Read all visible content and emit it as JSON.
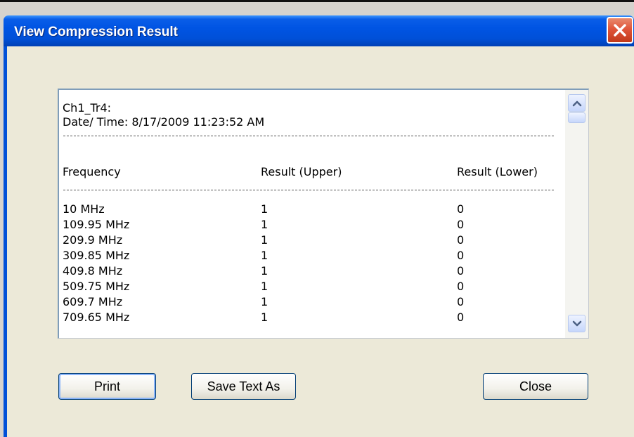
{
  "window": {
    "title": "View Compression Result"
  },
  "result": {
    "channel": "Ch1_Tr4:",
    "datetime": "Date/ Time: 8/17/2009 11:23:52 AM",
    "headers": [
      "Frequency",
      "Result (Upper)",
      "Result (Lower)"
    ],
    "rows": [
      [
        "10 MHz",
        "1",
        "0"
      ],
      [
        "109.95 MHz",
        "1",
        "0"
      ],
      [
        "209.9 MHz",
        "1",
        "0"
      ],
      [
        "309.85 MHz",
        "1",
        "0"
      ],
      [
        "409.8 MHz",
        "1",
        "0"
      ],
      [
        "509.75 MHz",
        "1",
        "0"
      ],
      [
        "609.7 MHz",
        "1",
        "0"
      ],
      [
        "709.65 MHz",
        "1",
        "0"
      ]
    ]
  },
  "buttons": {
    "print": "Print",
    "save_text_as": "Save Text As",
    "close": "Close"
  },
  "icons": {
    "close": "close-icon",
    "scroll_up": "chevron-up-icon",
    "scroll_down": "chevron-down-icon"
  },
  "colors": {
    "titlebar": "#0054e3",
    "dialog_background": "#ece9d8",
    "close_button": "#e0553a"
  }
}
